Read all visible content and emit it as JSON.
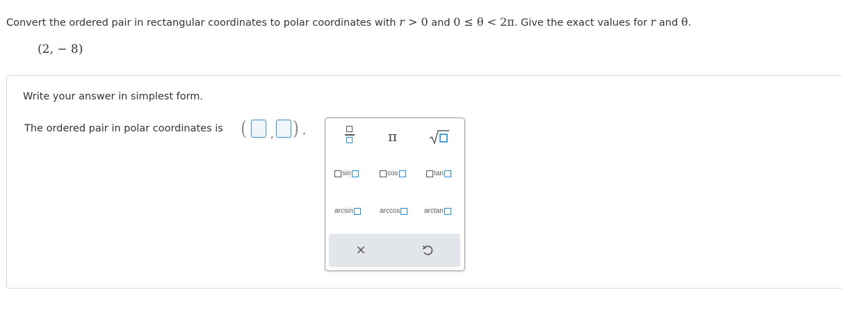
{
  "question": {
    "text_1": "Convert the ordered pair in rectangular coordinates to polar coordinates with ",
    "r_var": "r",
    "cond_1": " > 0",
    "text_and_1": " and ",
    "cond_2": "0 ≤ θ < 2π",
    "text_2": ". Give the exact values for ",
    "r_var_2": "r",
    "text_and_2": " and ",
    "theta": "θ",
    "text_end": "."
  },
  "given_point": "(2, − 8)",
  "answer": {
    "instruction": "Write your answer in simplest form.",
    "prompt": "The ordered pair in polar coordinates is",
    "open_paren": "(",
    "comma": ",",
    "close_paren": ")",
    "period": ".",
    "box_r_value": "",
    "box_theta_value": ""
  },
  "palette": {
    "fraction_icon": "fraction-icon",
    "pi_label": "π",
    "sqrt_icon": "square-root-icon",
    "sin_label": "sin",
    "cos_label": "cos",
    "tan_label": "tan",
    "arcsin_label": "arcsin",
    "arccos_label": "arccos",
    "arctan_label": "arctan",
    "clear_icon": "×",
    "undo_icon": "undo-icon"
  },
  "colors": {
    "accent": "#1d8fd0",
    "input_fill": "#eef6fb",
    "bar": "#e2e6ea"
  }
}
